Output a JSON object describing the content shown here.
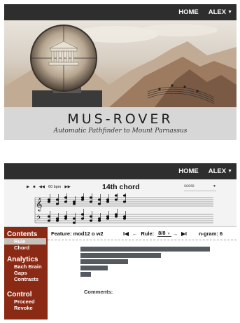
{
  "landing": {
    "nav": {
      "home": "HOME",
      "user": "ALEX"
    },
    "title": "MUS-ROVER",
    "subtitle": "Automatic Pathfinder to Mount Parnassus"
  },
  "app": {
    "nav": {
      "home": "HOME",
      "user": "ALEX"
    },
    "transport": {
      "play": "▶",
      "stop": "■",
      "rewind": "◀◀",
      "tempo": "60 bpm",
      "forward": "▶▶"
    },
    "chord_title": "14th chord",
    "score_select": "score",
    "sidebar": {
      "contents_header": "Contents",
      "contents_items": [
        "Rule",
        "Chord"
      ],
      "analytics_header": "Analytics",
      "analytics_items": [
        "Bach Brain",
        "Gaps",
        "Contrasts"
      ],
      "control_header": "Control",
      "control_items": [
        "Proceed",
        "Revoke"
      ]
    },
    "feature_bar": {
      "feature": "Feature: mod12 o w2",
      "first": "I◀",
      "prev": "←",
      "rule_label": "Rule:",
      "rule_value": "8/8",
      "next": "→",
      "last": "▶I",
      "ngram": "n-gram: 6"
    },
    "bar_values": [
      1.0,
      0.62,
      0.37,
      0.21,
      0.08
    ],
    "comments_label": "Comments:"
  },
  "colors": {
    "topbar": "#2e2e2e",
    "sidebar": "#8b2a14",
    "bars": "#555a60",
    "active_item": "#c7c1bb"
  }
}
